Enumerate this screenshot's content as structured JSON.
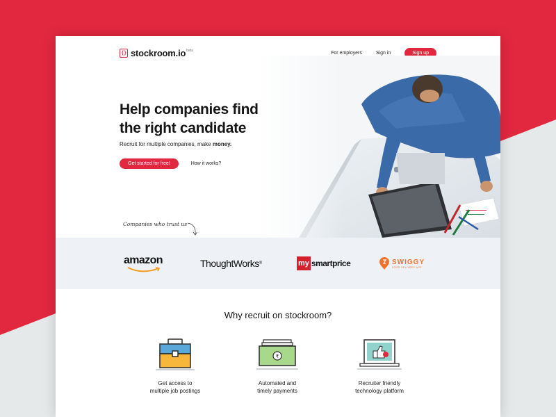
{
  "brand": {
    "name": "stockroom.io",
    "badge": "beta",
    "mark": "{ }",
    "accent": "#e2283f"
  },
  "nav": {
    "employers": "For employers",
    "signin": "Sign in",
    "signup": "Sign up"
  },
  "hero": {
    "title_line1": "Help companies find",
    "title_line2": "the right candidate",
    "subtitle_prefix": "Recruit for multiple companies, make ",
    "subtitle_emph": "money.",
    "cta_primary": "Get started for free!",
    "cta_secondary": "How it works?"
  },
  "companies": {
    "label": "Companies who trust us",
    "amazon": "amazon",
    "thoughtworks": "ThoughtWorks",
    "thoughtworks_mark": "®",
    "smartprice_prefix": "my",
    "smartprice_name": "smartprice",
    "swiggy_name": "SWIGGY",
    "swiggy_tagline": "FOOD DELIVERY APP"
  },
  "why": {
    "title": "Why recruit on stockroom?",
    "features": [
      {
        "icon": "briefcase-icon",
        "line1": "Get access to",
        "line2": "multiple job postings"
      },
      {
        "icon": "money-bill-icon",
        "line1": "Automated and",
        "line2": "timely payments"
      },
      {
        "icon": "laptop-thumbs-up-icon",
        "line1": "Recruiter friendly",
        "line2": "technology platform"
      }
    ]
  }
}
